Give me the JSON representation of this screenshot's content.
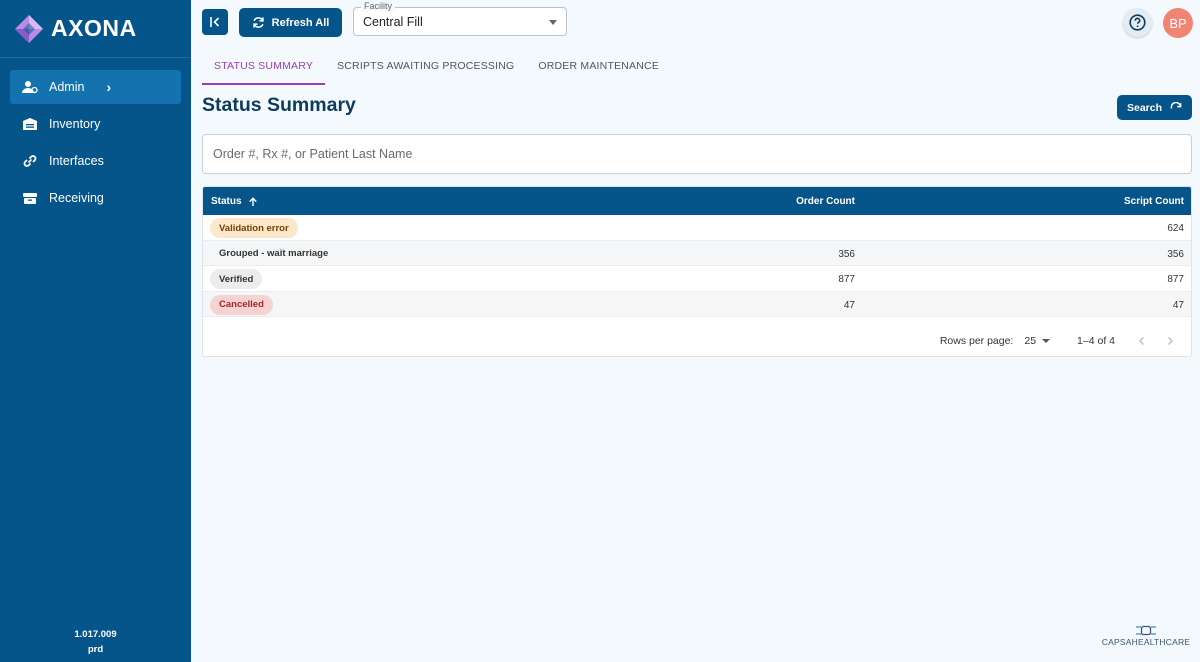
{
  "brand": {
    "name": "AXONA"
  },
  "sidebar": {
    "items": [
      {
        "label": "Admin",
        "icon": "admin-user-icon",
        "active": true
      },
      {
        "label": "Inventory",
        "icon": "warehouse-icon",
        "active": false
      },
      {
        "label": "Interfaces",
        "icon": "link-icon",
        "active": false
      },
      {
        "label": "Receiving",
        "icon": "box-icon",
        "active": false
      }
    ],
    "version": "1.017.009",
    "env": "prd"
  },
  "topbar": {
    "refresh_label": "Refresh All",
    "facility_label": "Facility",
    "facility_value": "Central Fill",
    "avatar_initials": "BP"
  },
  "tabs": [
    {
      "label": "STATUS SUMMARY",
      "active": true
    },
    {
      "label": "SCRIPTS AWAITING PROCESSING",
      "active": false
    },
    {
      "label": "ORDER MAINTENANCE",
      "active": false
    }
  ],
  "page": {
    "title": "Status Summary",
    "search_label": "Search",
    "search_placeholder": "Order #, Rx #, or Patient Last Name"
  },
  "table": {
    "headers": {
      "status": "Status",
      "order_count": "Order Count",
      "script_count": "Script Count"
    },
    "rows": [
      {
        "status": "Validation error",
        "order_count": "",
        "script_count": "624"
      },
      {
        "status": "Grouped - wait marriage",
        "order_count": "356",
        "script_count": "356"
      },
      {
        "status": "Verified",
        "order_count": "877",
        "script_count": "877"
      },
      {
        "status": "Cancelled",
        "order_count": "47",
        "script_count": "47"
      }
    ],
    "pagination": {
      "rows_per_page_label": "Rows per page:",
      "rows_per_page": "25",
      "range": "1–4 of 4"
    }
  },
  "footer": {
    "logo_text": "CAPSAHEALTHCARE"
  },
  "colors": {
    "primary": "#06558a",
    "accent_tab": "#9b3fb5",
    "avatar": "#f28474"
  }
}
